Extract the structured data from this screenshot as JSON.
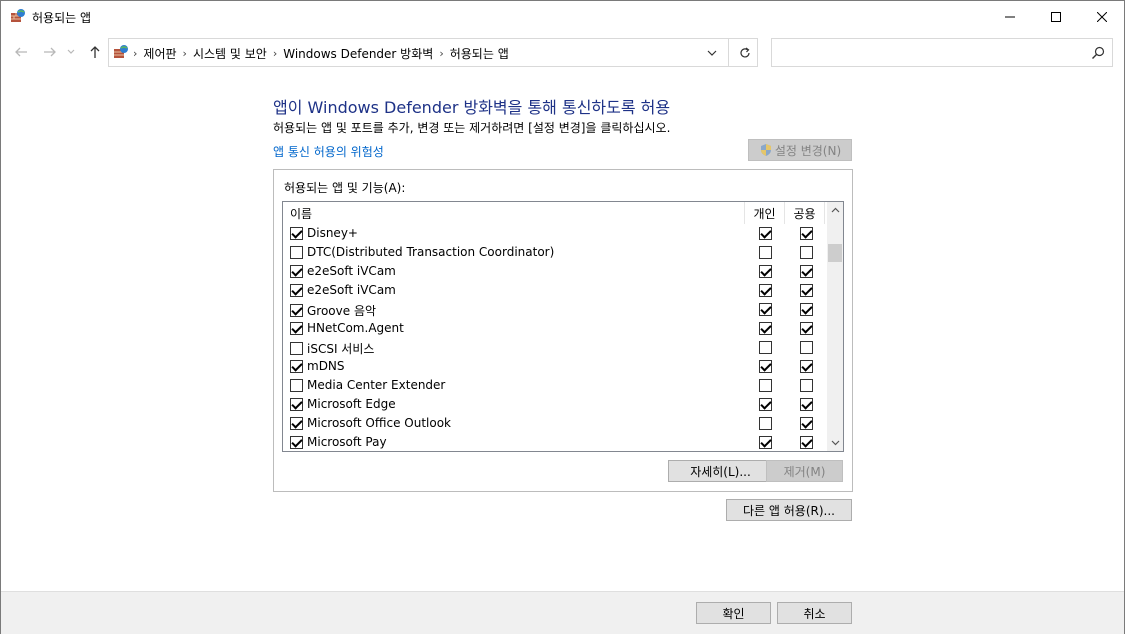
{
  "window": {
    "title": "허용되는 앱",
    "minimize_icon": "minimize-icon",
    "maximize_icon": "maximize-icon",
    "close_icon": "close-icon"
  },
  "nav": {
    "breadcrumbs": [
      "제어판",
      "시스템 및 보안",
      "Windows Defender 방화벽",
      "허용되는 앱"
    ],
    "search_placeholder": ""
  },
  "content": {
    "heading": "앱이 Windows Defender 방화벽을 통해 통신하도록 허용",
    "description": "허용되는 앱 및 포트를 추가, 변경 또는 제거하려면 [설정 변경]을 클릭하십시오.",
    "risk_link": "앱 통신 허용의 위험성",
    "settings_button": "설정 변경(N)",
    "group_label": "허용되는 앱 및 기능(A):",
    "columns": {
      "name": "이름",
      "private": "개인",
      "public": "공용"
    },
    "apps": [
      {
        "name": "Disney+",
        "enabled": true,
        "private": true,
        "public": true
      },
      {
        "name": "DTC(Distributed Transaction Coordinator)",
        "enabled": false,
        "private": false,
        "public": false
      },
      {
        "name": "e2eSoft iVCam",
        "enabled": true,
        "private": true,
        "public": true
      },
      {
        "name": "e2eSoft iVCam",
        "enabled": true,
        "private": true,
        "public": true
      },
      {
        "name": "Groove 음악",
        "enabled": true,
        "private": true,
        "public": true
      },
      {
        "name": "HNetCom.Agent",
        "enabled": true,
        "private": true,
        "public": true
      },
      {
        "name": "iSCSI 서비스",
        "enabled": false,
        "private": false,
        "public": false
      },
      {
        "name": "mDNS",
        "enabled": true,
        "private": true,
        "public": true
      },
      {
        "name": "Media Center Extender",
        "enabled": false,
        "private": false,
        "public": false
      },
      {
        "name": "Microsoft Edge",
        "enabled": true,
        "private": true,
        "public": true
      },
      {
        "name": "Microsoft Office Outlook",
        "enabled": true,
        "private": false,
        "public": true
      },
      {
        "name": "Microsoft Pay",
        "enabled": true,
        "private": true,
        "public": true
      }
    ],
    "details_button": "자세히(L)...",
    "remove_button": "제거(M)",
    "allow_other_button": "다른 앱 허용(R)..."
  },
  "footer": {
    "ok_button": "확인",
    "cancel_button": "취소"
  }
}
